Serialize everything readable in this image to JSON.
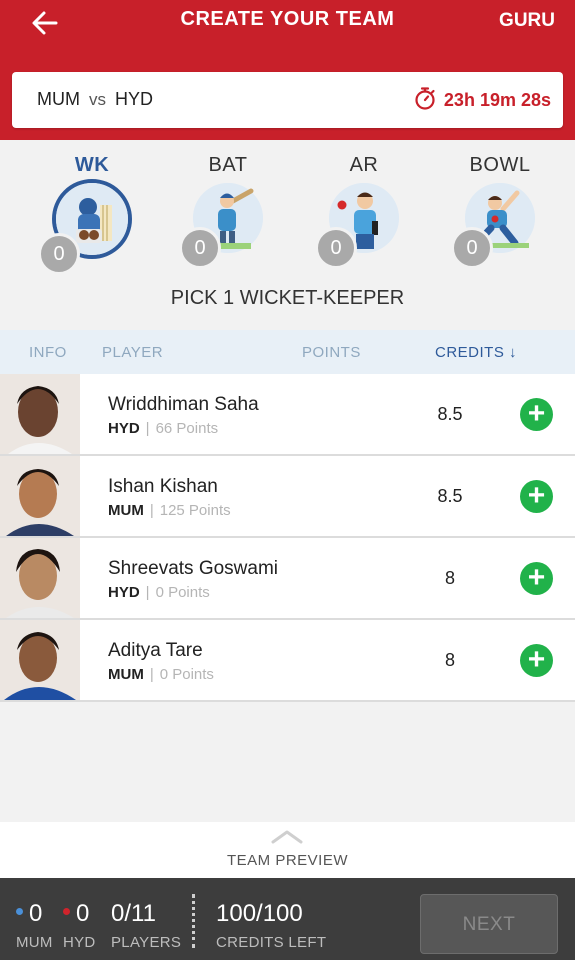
{
  "header": {
    "title": "CREATE YOUR TEAM",
    "guru_label": "GURU"
  },
  "match": {
    "team1": "MUM",
    "vs": "vs",
    "team2": "HYD",
    "countdown": "23h 19m 28s"
  },
  "roles": [
    {
      "label": "WK",
      "count": "0",
      "active": true
    },
    {
      "label": "BAT",
      "count": "0",
      "active": false
    },
    {
      "label": "AR",
      "count": "0",
      "active": false
    },
    {
      "label": "BOWL",
      "count": "0",
      "active": false
    }
  ],
  "pick_message": "PICK 1 WICKET-KEEPER",
  "columns": {
    "info": "INFO",
    "player": "PLAYER",
    "points": "POINTS",
    "credits": "CREDITS ↓"
  },
  "players": [
    {
      "name": "Wriddhiman Saha",
      "team": "HYD",
      "points_text": "66 Points",
      "credits": "8.5",
      "add": "+"
    },
    {
      "name": "Ishan Kishan",
      "team": "MUM",
      "points_text": "125 Points",
      "credits": "8.5",
      "add": "+"
    },
    {
      "name": "Shreevats Goswami",
      "team": "HYD",
      "points_text": "0 Points",
      "credits": "8",
      "add": "+"
    },
    {
      "name": "Aditya Tare",
      "team": "MUM",
      "points_text": "0 Points",
      "credits": "8",
      "add": "+"
    }
  ],
  "preview_label": "TEAM PREVIEW",
  "footer": {
    "mum_count": "0",
    "mum_label": "MUM",
    "hyd_count": "0",
    "hyd_label": "HYD",
    "players_count": "0/11",
    "players_label": "PLAYERS",
    "credits_value": "100/100",
    "credits_label": "CREDITS LEFT",
    "next_label": "NEXT"
  },
  "colors": {
    "brand_red": "#c8202a",
    "accent_blue": "#2e5a9a",
    "add_green": "#21b24a",
    "mum_dot": "#4a90d9",
    "hyd_dot": "#d0242c"
  },
  "icons": {
    "back": "arrow-left-icon",
    "timer": "stopwatch-icon",
    "add": "plus-icon",
    "preview": "chevron-up-icon"
  }
}
